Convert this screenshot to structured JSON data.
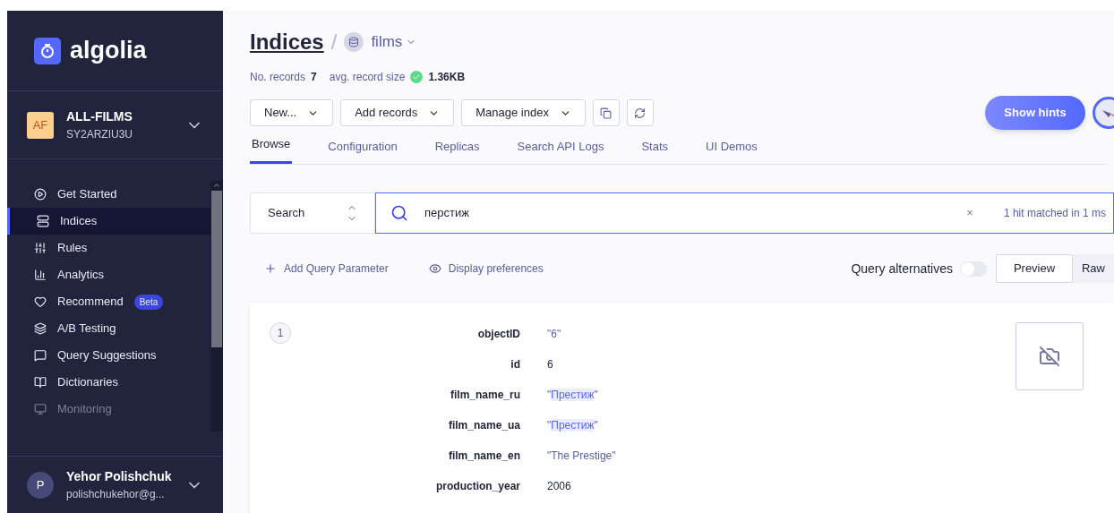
{
  "logo": {
    "text": "algolia"
  },
  "app": {
    "initials": "AF",
    "name": "ALL-FILMS",
    "id": "SY2ARZIU3U"
  },
  "nav": [
    {
      "label": "Get Started",
      "selected": false,
      "disabled": false
    },
    {
      "label": "Indices",
      "selected": true,
      "disabled": false
    },
    {
      "label": "Rules",
      "selected": false,
      "disabled": false
    },
    {
      "label": "Analytics",
      "selected": false,
      "disabled": false
    },
    {
      "label": "Recommend",
      "selected": false,
      "disabled": false,
      "badge": "Beta"
    },
    {
      "label": "A/B Testing",
      "selected": false,
      "disabled": false
    },
    {
      "label": "Query Suggestions",
      "selected": false,
      "disabled": false
    },
    {
      "label": "Dictionaries",
      "selected": false,
      "disabled": false
    },
    {
      "label": "Monitoring",
      "selected": false,
      "disabled": true
    }
  ],
  "user": {
    "initial": "P",
    "name": "Yehor Polishchuk",
    "email": "polishchukehor@g..."
  },
  "breadcrumb": {
    "root": "Indices",
    "separator": "/",
    "index": "films"
  },
  "stats": [
    {
      "label": "No. records",
      "value": "7",
      "ok": false
    },
    {
      "label": "avg. record size",
      "value": "1.36KB",
      "ok": true
    }
  ],
  "toolbar": [
    "New...",
    "Add records",
    "Manage index"
  ],
  "hints_button": "Show hints",
  "tabs": [
    {
      "label": "Browse",
      "selected": true
    },
    {
      "label": "Configuration",
      "selected": false
    },
    {
      "label": "Replicas",
      "selected": false
    },
    {
      "label": "Search API Logs",
      "selected": false
    },
    {
      "label": "Stats",
      "selected": false
    },
    {
      "label": "UI Demos",
      "selected": false
    }
  ],
  "search": {
    "mode": "Search",
    "query": "перстиж",
    "clear": "×",
    "result": "1 hit matched in 1 ms"
  },
  "options": {
    "add_param": "Add Query Parameter",
    "display": "Display preferences",
    "alternatives": "Query alternatives",
    "alternatives_on": false,
    "views": [
      {
        "label": "Preview",
        "selected": true
      },
      {
        "label": "Raw",
        "selected": false
      }
    ]
  },
  "record": {
    "number": "1",
    "fields": [
      {
        "key": "objectID",
        "kind": "string",
        "value": [
          {
            "text": "\"6\"",
            "highlighted": false
          }
        ]
      },
      {
        "key": "id",
        "kind": "number",
        "value": [
          {
            "text": "6",
            "highlighted": false
          }
        ]
      },
      {
        "key": "film_name_ru",
        "kind": "string",
        "value": [
          {
            "text": "\"",
            "highlighted": false
          },
          {
            "text": "Престиж",
            "highlighted": true
          },
          {
            "text": "\"",
            "highlighted": false
          }
        ]
      },
      {
        "key": "film_name_ua",
        "kind": "string",
        "value": [
          {
            "text": "\"",
            "highlighted": false
          },
          {
            "text": "Престиж",
            "highlighted": true
          },
          {
            "text": "\"",
            "highlighted": false
          }
        ]
      },
      {
        "key": "film_name_en",
        "kind": "string",
        "value": [
          {
            "text": "\"The Prestige\"",
            "highlighted": false
          }
        ]
      },
      {
        "key": "production_year",
        "kind": "number",
        "value": [
          {
            "text": "2006",
            "highlighted": false
          }
        ]
      }
    ]
  }
}
